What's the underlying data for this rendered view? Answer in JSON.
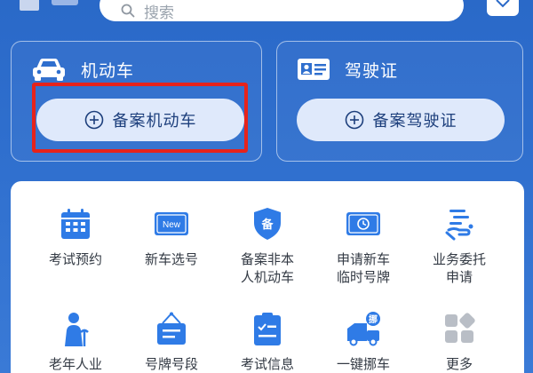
{
  "search": {
    "placeholder": "搜索"
  },
  "cards": {
    "vehicle": {
      "title": "机动车",
      "action": "备案机动车"
    },
    "license": {
      "title": "驾驶证",
      "action": "备案驾驶证"
    }
  },
  "services": [
    {
      "label": "考试预约"
    },
    {
      "label": "新车选号",
      "badge": "New"
    },
    {
      "label": "备案非本\n人机动车",
      "badge": "备"
    },
    {
      "label": "申请新车\n临时号牌"
    },
    {
      "label": "业务委托\n申请"
    },
    {
      "label": "老年人业"
    },
    {
      "label": "号牌号段"
    },
    {
      "label": "考试信息"
    },
    {
      "label": "一键挪车",
      "badge": "挪"
    },
    {
      "label": "更多"
    }
  ],
  "colors": {
    "primary": "#2a69c8",
    "icon_blue": "#2f7be6",
    "highlight": "#e6231b"
  }
}
